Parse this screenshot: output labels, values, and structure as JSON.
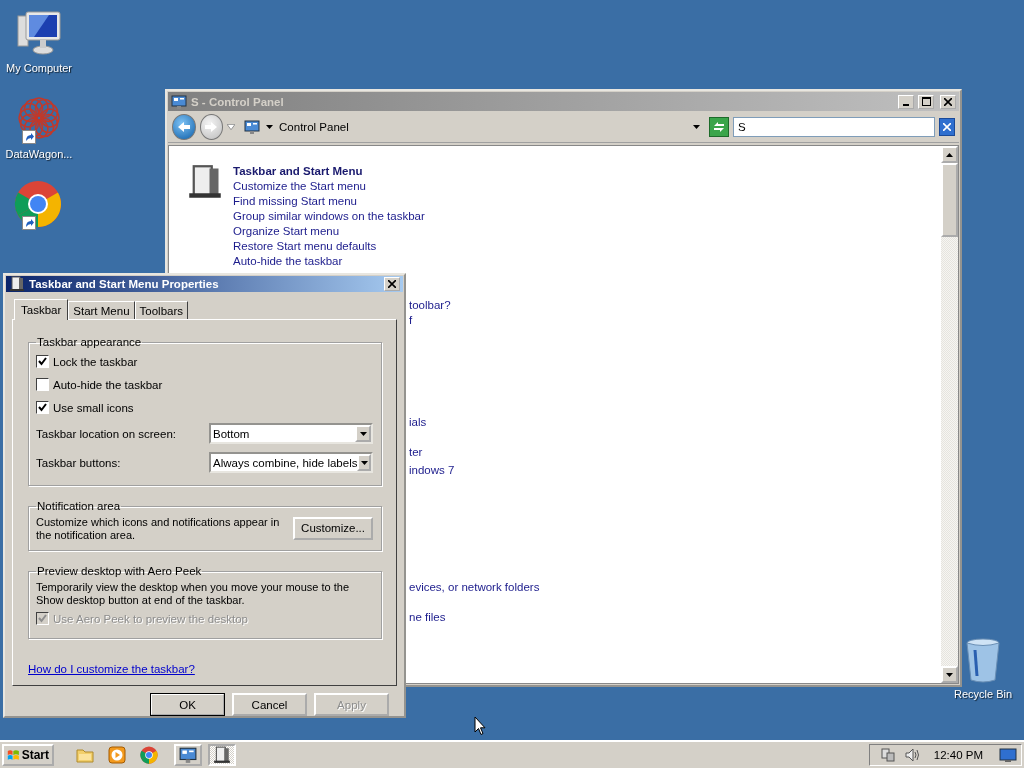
{
  "desktop_icons": [
    {
      "kind": "computer",
      "label": "My Computer",
      "shortcut": false
    },
    {
      "kind": "app",
      "label": "DataWagon...",
      "shortcut": true
    },
    {
      "kind": "chrome",
      "shortcut": true
    }
  ],
  "recycle_bin": {
    "label": "Recycle Bin"
  },
  "control_panel": {
    "title": "S - Control Panel",
    "active": false,
    "nav": [
      {
        "kind": "back",
        "disabled": false
      },
      {
        "kind": "forward",
        "disabled": true
      }
    ],
    "address": "Control Panel",
    "search": {
      "value": "S"
    },
    "category": {
      "title": "Taskbar and Start Menu",
      "links": [
        "Customize the Start menu",
        "Find missing Start menu",
        "Group similar windows on the taskbar",
        "Organize Start menu",
        "Restore Start menu defaults",
        "Auto-hide the taskbar"
      ]
    },
    "fragments": [
      "toolbar?",
      "f",
      "ials",
      "ter",
      "indows 7",
      "evices, or network folders",
      "ne files"
    ]
  },
  "dialog": {
    "title": "Taskbar and Start Menu Properties",
    "active": true,
    "tabs": [
      {
        "label": "Taskbar",
        "selected": true
      },
      {
        "label": "Start Menu",
        "selected": false
      },
      {
        "label": "Toolbars",
        "selected": false
      }
    ],
    "appearance": {
      "legend": "Taskbar appearance",
      "checkboxes": [
        {
          "label": "Lock the taskbar",
          "checked": true
        },
        {
          "label": "Auto-hide the taskbar",
          "checked": false
        },
        {
          "label": "Use small icons",
          "checked": true
        }
      ],
      "selects": [
        {
          "label": "Taskbar location on screen:",
          "value": "Bottom"
        },
        {
          "label": "Taskbar buttons:",
          "value": "Always combine, hide labels"
        }
      ]
    },
    "notification": {
      "legend": "Notification area",
      "text": "Customize which icons and notifications appear in the notification area.",
      "button": "Customize..."
    },
    "peek": {
      "legend": "Preview desktop with Aero Peek",
      "text": "Temporarily view the desktop when you move your mouse to the Show desktop button at end of the taskbar.",
      "checkbox": {
        "label": "Use Aero Peek to preview the desktop",
        "checked": true,
        "disabled": true
      }
    },
    "help_link": "How do I customize the taskbar?",
    "buttons": [
      {
        "label": "OK",
        "default": true,
        "disabled": false
      },
      {
        "label": "Cancel",
        "default": false,
        "disabled": false
      },
      {
        "label": "Apply",
        "default": false,
        "disabled": true
      }
    ]
  },
  "taskbar": {
    "start": "Start",
    "quick_launch": [
      {
        "kind": "folder"
      },
      {
        "kind": "media"
      },
      {
        "kind": "chrome"
      }
    ],
    "tasks": [
      {
        "kind": "control-panel",
        "selected": false
      },
      {
        "kind": "taskbar-properties",
        "selected": true
      }
    ],
    "clock": "12:40 PM"
  }
}
